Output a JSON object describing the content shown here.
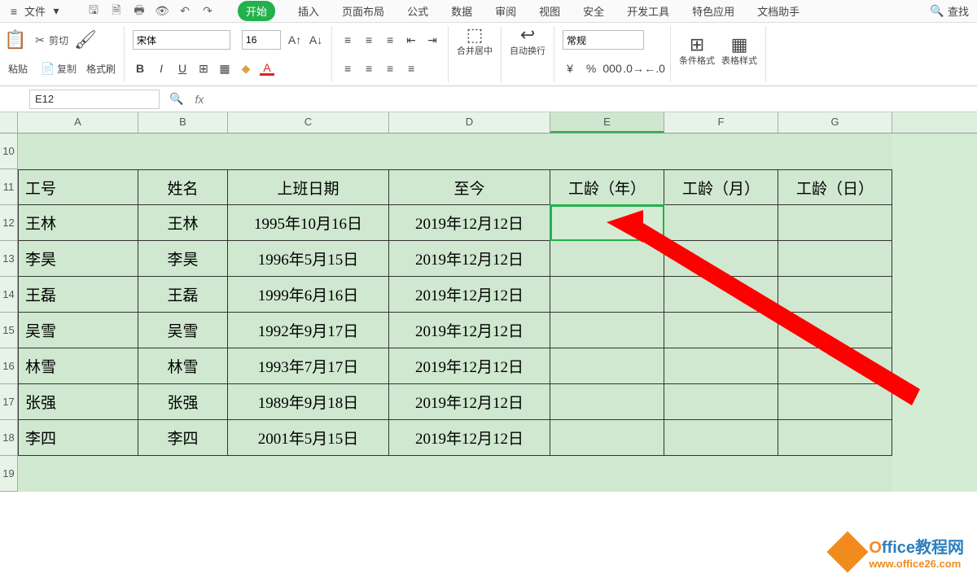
{
  "menu": {
    "file": "文件",
    "tabs": [
      "开始",
      "插入",
      "页面布局",
      "公式",
      "数据",
      "审阅",
      "视图",
      "安全",
      "开发工具",
      "特色应用",
      "文档助手"
    ],
    "active": "开始",
    "search": "查找"
  },
  "ribbon": {
    "paste": "粘贴",
    "cut": "剪切",
    "copy": "复制",
    "format_painter": "格式刷",
    "font_name": "宋体",
    "font_size": "16",
    "merge_center": "合并居中",
    "wrap_text": "自动换行",
    "number_format": "常规",
    "conditional": "条件格式",
    "table_style": "表格样式"
  },
  "namebox": "E12",
  "columns": [
    "A",
    "B",
    "C",
    "D",
    "E",
    "F",
    "G"
  ],
  "selected_col": "E",
  "headers": {
    "A": "工号",
    "B": "姓名",
    "C": "上班日期",
    "D": "至今",
    "E": "工龄（年）",
    "F": "工龄（月）",
    "G": "工龄（日）"
  },
  "rows": [
    {
      "n": "12",
      "A": "王林",
      "B": "王林",
      "C": "1995年10月16日",
      "D": "2019年12月12日",
      "E": "",
      "F": "",
      "G": ""
    },
    {
      "n": "13",
      "A": "李昊",
      "B": "李昊",
      "C": "1996年5月15日",
      "D": "2019年12月12日",
      "E": "",
      "F": "",
      "G": ""
    },
    {
      "n": "14",
      "A": "王磊",
      "B": "王磊",
      "C": "1999年6月16日",
      "D": "2019年12月12日",
      "E": "",
      "F": "",
      "G": ""
    },
    {
      "n": "15",
      "A": "吴雪",
      "B": "吴雪",
      "C": "1992年9月17日",
      "D": "2019年12月12日",
      "E": "",
      "F": "",
      "G": ""
    },
    {
      "n": "16",
      "A": "林雪",
      "B": "林雪",
      "C": "1993年7月17日",
      "D": "2019年12月12日",
      "E": "",
      "F": "",
      "G": ""
    },
    {
      "n": "17",
      "A": "张强",
      "B": "张强",
      "C": "1989年9月18日",
      "D": "2019年12月12日",
      "E": "",
      "F": "",
      "G": ""
    },
    {
      "n": "18",
      "A": "李四",
      "B": "李四",
      "C": "2001年5月15日",
      "D": "2019年12月12日",
      "E": "",
      "F": "",
      "G": ""
    }
  ],
  "header_row": "11",
  "empty_rows": [
    "10",
    "19"
  ],
  "watermark": {
    "brand_prefix": "O",
    "brand_rest": "ffice教程网",
    "url": "www.office26.com"
  }
}
